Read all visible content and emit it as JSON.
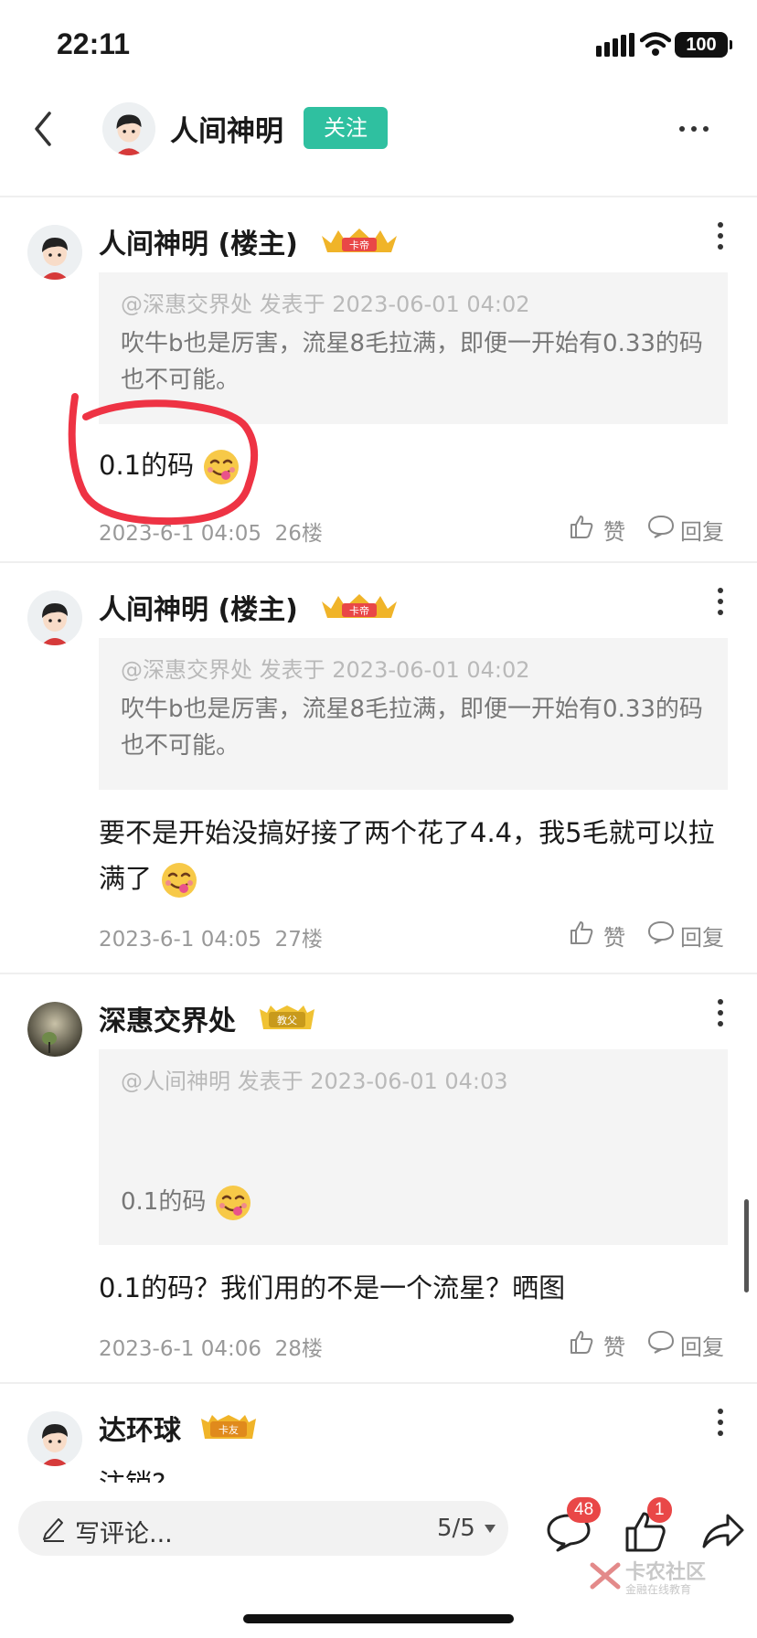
{
  "status_bar": {
    "time": "22:11",
    "battery": "100"
  },
  "nav": {
    "title": "人间神明",
    "follow_label": "关注"
  },
  "ghost_row": {
    "like": "赞",
    "reply": "回复"
  },
  "posts": [
    {
      "author": "人间神明 (楼主)",
      "badge": "卡帝",
      "quote_meta": "@深惠交界处 发表于 2023-06-01 04:02",
      "quote_text": "吹牛b也是厉害，流星8毛拉满，即便一开始有0.33的码也不可能。",
      "body": "0.1的码",
      "timestamp": "2023-6-1 04:05",
      "floor": "26楼",
      "like": "赞",
      "reply": "回复"
    },
    {
      "author": "人间神明 (楼主)",
      "badge": "卡帝",
      "quote_meta": "@深惠交界处 发表于 2023-06-01 04:02",
      "quote_text": "吹牛b也是厉害，流星8毛拉满，即便一开始有0.33的码也不可能。",
      "body": "要不是开始没搞好接了两个花了4.4，我5毛就可以拉满了",
      "timestamp": "2023-6-1 04:05",
      "floor": "27楼",
      "like": "赞",
      "reply": "回复"
    },
    {
      "author": "深惠交界处",
      "badge": "教父",
      "quote_meta": "@人间神明 发表于 2023-06-01 04:03",
      "quote_text": "0.1的码",
      "body": "0.1的码？我们用的不是一个流星？晒图",
      "timestamp": "2023-6-1 04:06",
      "floor": "28楼",
      "like": "赞",
      "reply": "回复"
    },
    {
      "author": "达环球",
      "badge": "卡友",
      "body": "注销?"
    }
  ],
  "bottom_bar": {
    "comment_placeholder": "写评论...",
    "page_indicator": "5/5",
    "comment_count": "48",
    "like_count": "1",
    "watermark_title": "卡农社区",
    "watermark_sub": "金融在线教育"
  },
  "colors": {
    "follow": "#2fc0a0",
    "badge_red": "#e94747",
    "annotation": "#ee3344"
  }
}
